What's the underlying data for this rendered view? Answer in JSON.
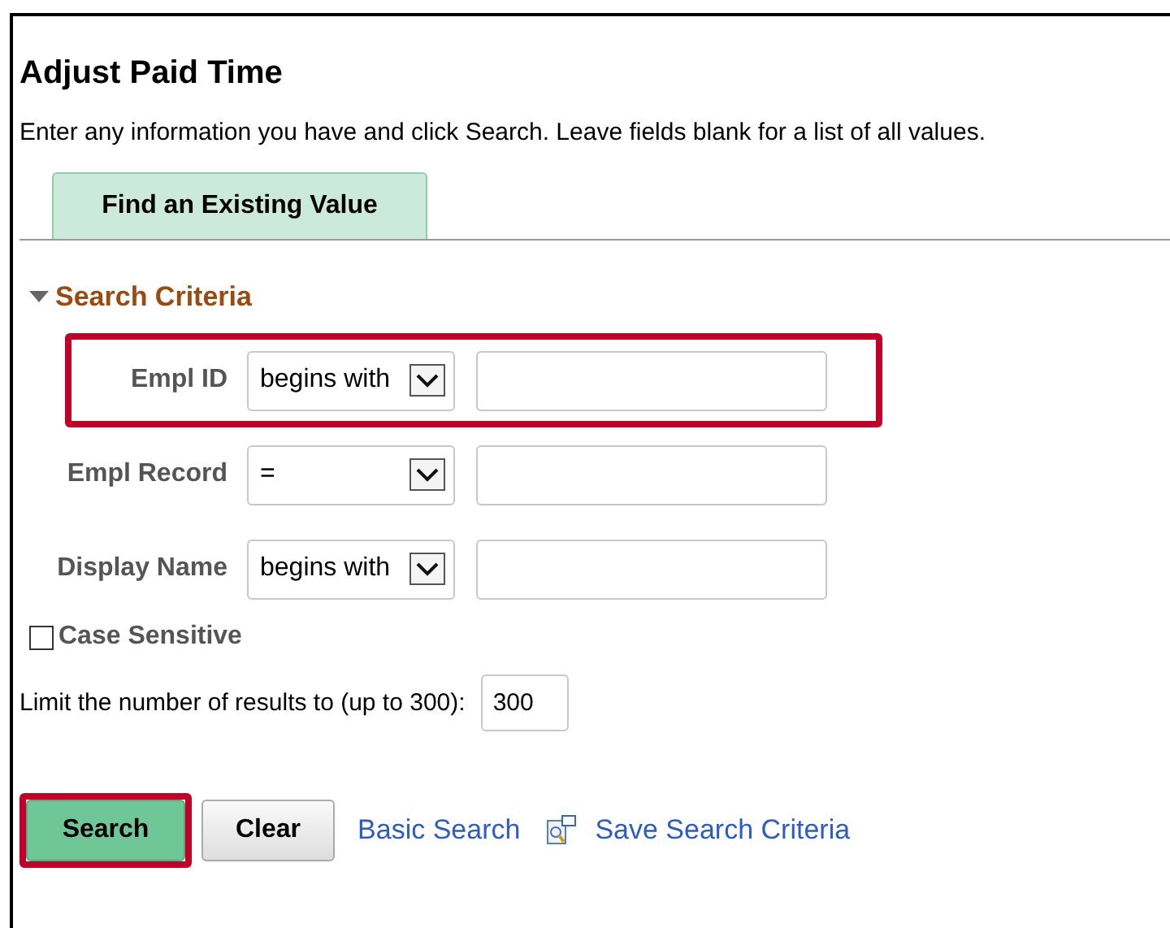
{
  "page": {
    "title": "Adjust Paid Time",
    "instructions": "Enter any information you have and click Search. Leave fields blank for a list of all values."
  },
  "tabs": [
    {
      "label": "Find an Existing Value",
      "selected": true
    }
  ],
  "section": {
    "label": "Search Criteria",
    "expanded": true
  },
  "fields": [
    {
      "label": "Empl ID",
      "operator": "begins with",
      "highlighted": true
    },
    {
      "label": "Empl Record",
      "operator": "=",
      "highlighted": false
    },
    {
      "label": "Display Name",
      "operator": "begins with",
      "highlighted": false
    }
  ],
  "case_sensitive": {
    "label": "Case Sensitive",
    "checked": false
  },
  "limit": {
    "label": "Limit the number of results to (up to 300):",
    "value": "300"
  },
  "actions": [
    {
      "kind": "primary",
      "label": "Search",
      "highlighted": true
    },
    {
      "kind": "button",
      "label": "Clear",
      "highlighted": false
    },
    {
      "kind": "link",
      "label": "Basic Search",
      "highlighted": false
    },
    {
      "kind": "icon-link",
      "label": "Save Search Criteria",
      "highlighted": false
    }
  ]
}
